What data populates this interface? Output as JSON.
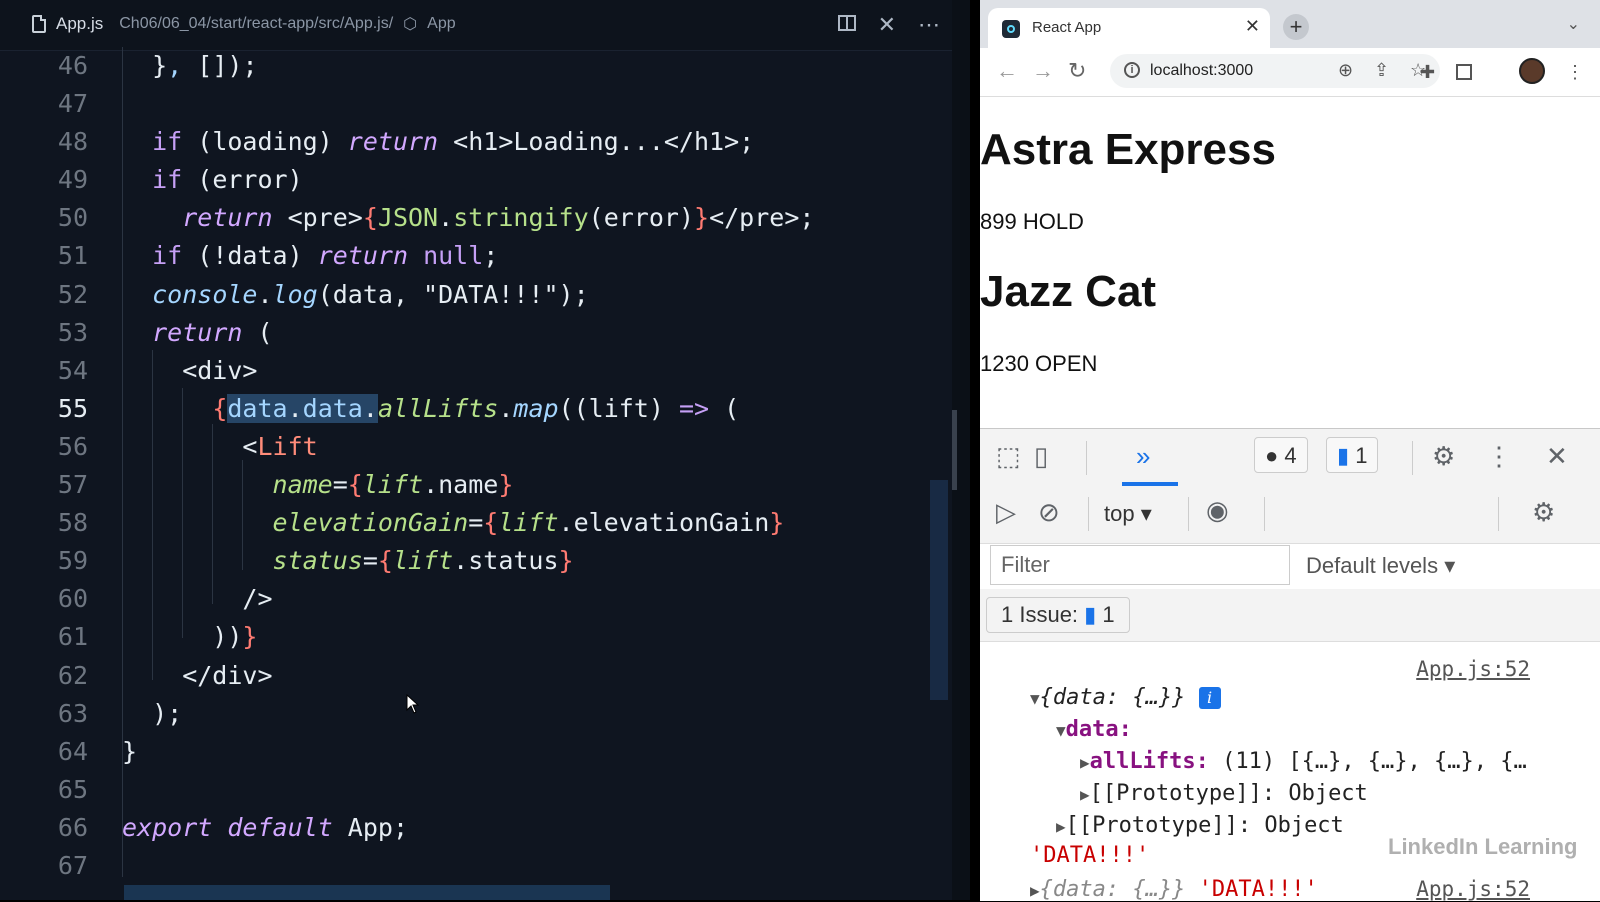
{
  "editor": {
    "filename": "App.js",
    "path": "Ch06/06_04/start/react-app/src/App.js/",
    "breadcrumb_symbol": "App",
    "active_line": "55",
    "line_numbers": [
      "46",
      "47",
      "48",
      "49",
      "50",
      "51",
      "52",
      "53",
      "54",
      "55",
      "56",
      "57",
      "58",
      "59",
      "60",
      "61",
      "62",
      "63",
      "64",
      "65",
      "66",
      "67"
    ]
  },
  "browser": {
    "tab_title": "React App",
    "url": "localhost:3000",
    "page": {
      "lift1_name": "Astra Express",
      "lift1_info": "899 HOLD",
      "lift2_name": "Jazz Cat",
      "lift2_info": "1230 OPEN"
    }
  },
  "devtools": {
    "errors_count": "4",
    "messages_count": "1",
    "context": "top",
    "filter_placeholder": "Filter",
    "levels": "Default levels",
    "issues_label": "1 Issue:",
    "issues_count": "1",
    "source_link": "App.js:52",
    "source_link2": "App.js:52",
    "log": {
      "root": "{data: {…}}",
      "data_key": "data:",
      "alllifts_key": "allLifts:",
      "alllifts_val": "(11) [{…}, {…}, {…}, {…",
      "proto_key": "[[Prototype]]:",
      "proto_val": "Object",
      "string_val": "'DATA!!!'",
      "next_root": "{data: {…}}",
      "next_string": "'DATA!!!'"
    }
  },
  "watermark": "LinkedIn Learning",
  "colors": {
    "editor_bg": "#0f1520",
    "selection": "#264566",
    "accent": "#1a73e8"
  }
}
